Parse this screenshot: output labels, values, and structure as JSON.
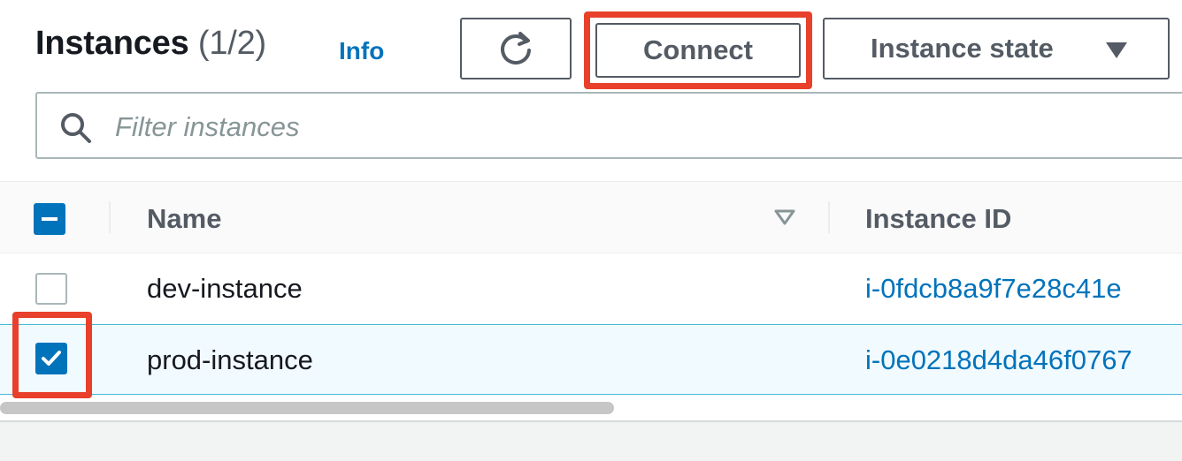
{
  "header": {
    "title": "Instances",
    "count": "(1/2)",
    "info_link": "Info"
  },
  "toolbar": {
    "refresh_icon": "refresh-icon",
    "connect_label": "Connect",
    "instance_state_label": "Instance state",
    "instance_state_icon": "caret-down-icon"
  },
  "search": {
    "placeholder": "Filter instances",
    "value": "",
    "icon": "search-icon"
  },
  "table": {
    "select_all_state": "indeterminate",
    "columns": [
      "Name",
      "Instance ID"
    ],
    "rows": [
      {
        "selected": false,
        "name": "dev-instance",
        "instance_id": "i-0fdcb8a9f7e28c41e"
      },
      {
        "selected": true,
        "name": "prod-instance",
        "instance_id": "i-0e0218d4da46f0767"
      }
    ]
  },
  "colors": {
    "accent": "#0073bb",
    "highlight": "#e8402a",
    "selected_row_bg": "#f1faff",
    "text_secondary": "#545b64"
  }
}
